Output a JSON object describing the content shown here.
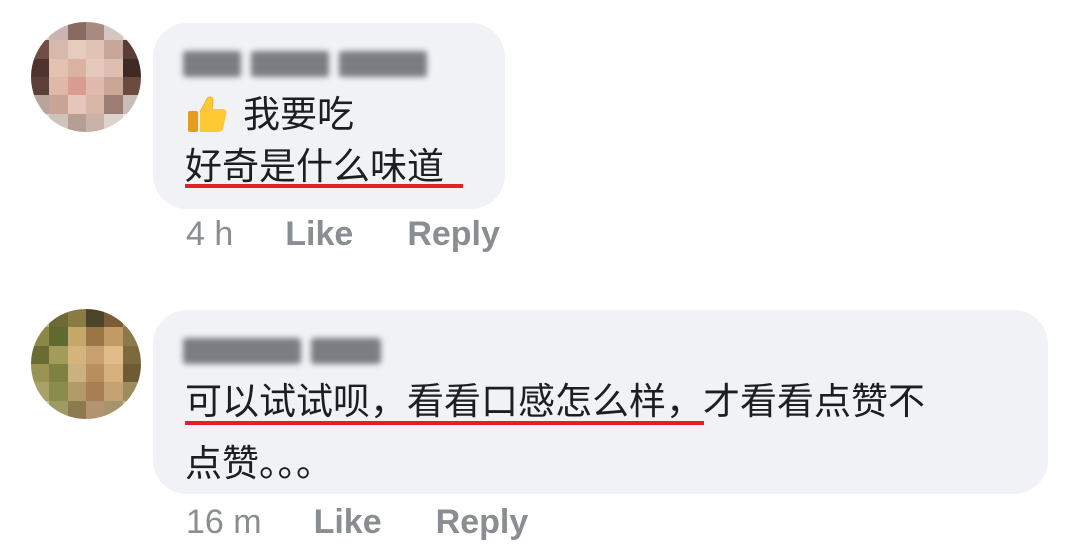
{
  "comments": [
    {
      "author_name": "Pei Wei Tong",
      "lines": [
        "我要吃",
        "好奇是什么味道"
      ],
      "emoji": "thumbs-up",
      "time": "4 h",
      "like_label": "Like",
      "reply_label": "Reply"
    },
    {
      "author_name": "Marilyn Goh",
      "lines": [
        "可以试试呗，看看口感怎么样，才看看点赞不",
        "点赞。。。"
      ],
      "time": "16 m",
      "like_label": "Like",
      "reply_label": "Reply"
    }
  ],
  "colors": {
    "bubble_bg": "#f0f2f5",
    "text": "#1c1e21",
    "meta": "#8a8d91",
    "annotation_underline": "#e0202a"
  }
}
